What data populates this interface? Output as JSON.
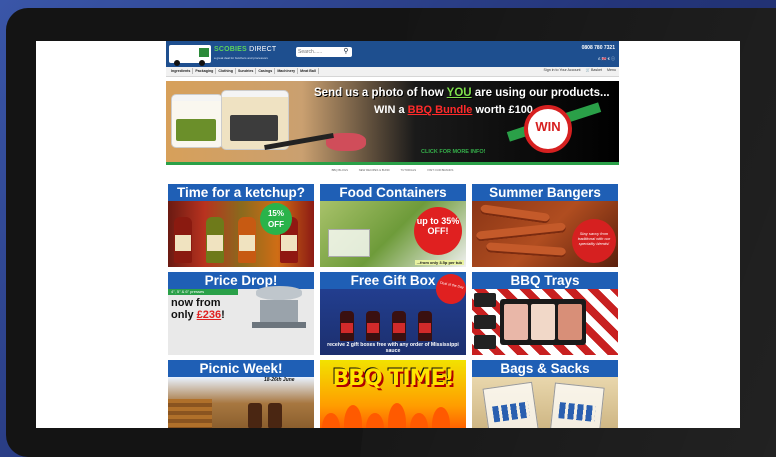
{
  "colors": {
    "header_blue": "#1e4f8f",
    "tile_blue": "#1f5fb5",
    "accent_green": "#2aa048",
    "accent_red": "#e02020"
  },
  "header": {
    "logo_name": "SCOBIES",
    "logo_name_suffix": "DIRECT",
    "logo_tagline": "a great deal for butchers and processors",
    "search_placeholder": "Search......",
    "phone": "0808 780 7321",
    "flags_text": "£ 🇬🇧   € ⓘ"
  },
  "nav": {
    "items": [
      "Ingredients",
      "Packaging",
      "Clothing",
      "Sundries",
      "Casings",
      "Machinery",
      "Meat Ball"
    ],
    "account_label": "Sign in to Your Account",
    "basket_label": "Basket",
    "menu_label": "Menu"
  },
  "banner": {
    "line1_prefix": "Send us a photo of how ",
    "line1_highlight": "YOU",
    "line1_suffix": " are using our products...",
    "line2_prefix": "WIN a ",
    "line2_highlight": "BBQ Bundle",
    "line2_suffix": " worth £100",
    "badge": "WIN",
    "cta": "CLICK FOR MORE INFO!",
    "tub_brand": "Serpentina"
  },
  "subnav": [
    "BBQ BLOGS",
    "NEW RECIPES & BUND",
    "TUTORIALS",
    "VISIT OUR BRANDS"
  ],
  "tiles": [
    {
      "title": "Time for a ketchup?",
      "badge": "15% OFF"
    },
    {
      "title": "Food Containers",
      "badge": "up to 35% OFF!",
      "note": "...from only 3.5p per tub"
    },
    {
      "title": "Summer Bangers",
      "badge": "Stay savvy from traditional with our speciality blends!"
    },
    {
      "title": "Price Drop!",
      "subtitle": "4\", 5\" & 6\" presses",
      "now_from": "now from",
      "only": "only ",
      "price": "£236",
      "price_suffix": "!"
    },
    {
      "title": "Free Gift Box",
      "badge": "Deal of the Day",
      "caption": "receive 2 gift boxes free with any order of Mississippi sauce"
    },
    {
      "title": "BBQ Trays"
    },
    {
      "title": "Picnic Week!",
      "date": "18-26th June"
    },
    {
      "title": "BBQ TIME!"
    },
    {
      "title": "Bags & Sacks"
    }
  ]
}
